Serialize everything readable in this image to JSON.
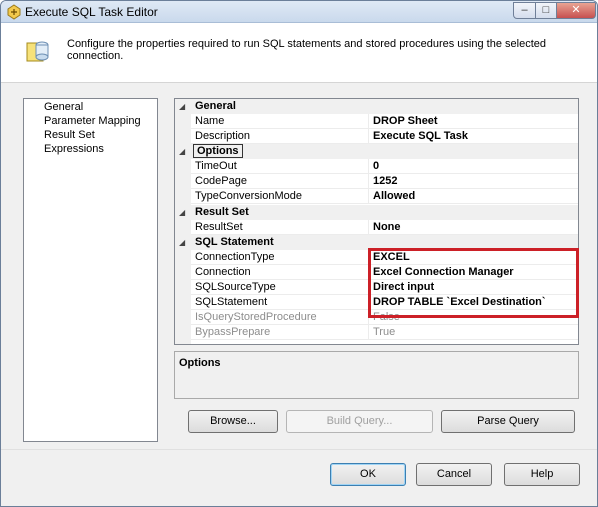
{
  "window": {
    "title": "Execute SQL Task Editor",
    "controls": {
      "minimize": "–",
      "maximize": "□",
      "close": "✕"
    }
  },
  "header": {
    "description": "Configure the properties required to run SQL statements and stored procedures using the selected connection."
  },
  "nav": {
    "items": [
      {
        "label": "General"
      },
      {
        "label": "Parameter Mapping"
      },
      {
        "label": "Result Set"
      },
      {
        "label": "Expressions"
      }
    ]
  },
  "properties": {
    "general": {
      "category": "General",
      "name": {
        "label": "Name",
        "value": "DROP Sheet"
      },
      "description": {
        "label": "Description",
        "value": "Execute SQL Task"
      }
    },
    "options": {
      "category": "Options",
      "timeout": {
        "label": "TimeOut",
        "value": "0"
      },
      "codepage": {
        "label": "CodePage",
        "value": "1252"
      },
      "typeconversion": {
        "label": "TypeConversionMode",
        "value": "Allowed"
      }
    },
    "resultset": {
      "category": "Result Set",
      "resultset": {
        "label": "ResultSet",
        "value": "None"
      }
    },
    "sql": {
      "category": "SQL Statement",
      "connectiontype": {
        "label": "ConnectionType",
        "value": "EXCEL"
      },
      "connection": {
        "label": "Connection",
        "value": "Excel Connection Manager"
      },
      "sqlsourcetype": {
        "label": "SQLSourceType",
        "value": "Direct input"
      },
      "sqlstatement": {
        "label": "SQLStatement",
        "value": "DROP TABLE `Excel Destination`"
      },
      "isquerystoredprocedure": {
        "label": "IsQueryStoredProcedure",
        "value": "False"
      },
      "bypassprepare": {
        "label": "BypassPrepare",
        "value": "True"
      }
    }
  },
  "description_pane": {
    "title": "Options"
  },
  "buttons": {
    "browse": "Browse...",
    "build_query": "Build Query...",
    "parse_query": "Parse Query",
    "ok": "OK",
    "cancel": "Cancel",
    "help": "Help"
  },
  "colors": {
    "highlight": "#cc2027",
    "window_bg": "#f0f0f0"
  }
}
